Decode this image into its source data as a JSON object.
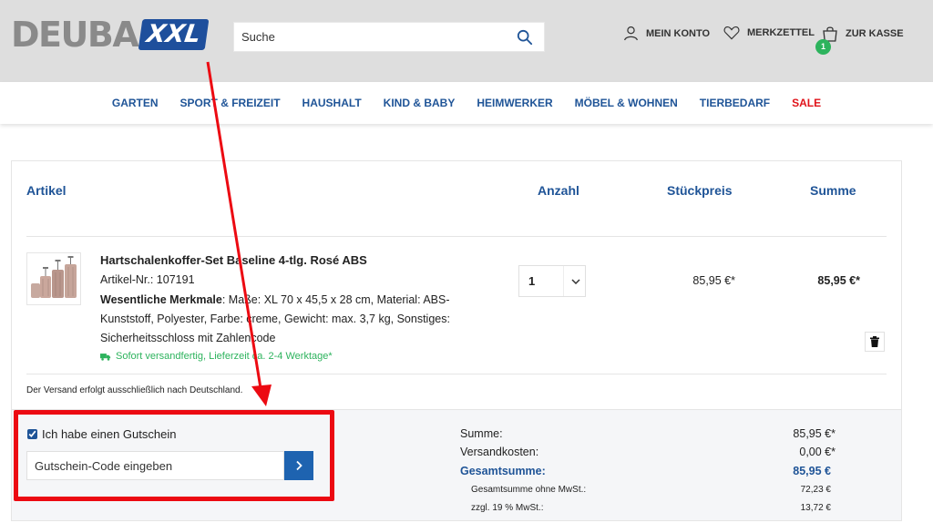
{
  "header": {
    "logo_main": "DEUBA",
    "logo_suffix": "XXL",
    "search_placeholder": "Suche",
    "account_label": "MEIN KONTO",
    "wishlist_label": "MERKZETTEL",
    "checkout_label": "ZUR KASSE",
    "cart_count": "1"
  },
  "nav": {
    "items": [
      "GARTEN",
      "SPORT & FREIZEIT",
      "HAUSHALT",
      "KIND & BABY",
      "HEIMWERKER",
      "MÖBEL & WOHNEN",
      "TIERBEDARF"
    ],
    "sale_label": "SALE"
  },
  "cart": {
    "col_article": "Artikel",
    "col_qty": "Anzahl",
    "col_unit_price": "Stückpreis",
    "col_total": "Summe",
    "item": {
      "title": "Hartschalenkoffer-Set Baseline 4-tlg. Rosé ABS",
      "article_no": "Artikel-Nr.: 107191",
      "features_label": "Wesentliche Merkmale",
      "features_text": ": Maße: XL 70 x 45,5 x 28 cm, Material: ABS-Kunststoff, Polyester, Farbe: creme, Gewicht: max. 3,7 kg, Sonstiges: Sicherheitsschloss mit Zahlencode",
      "shipping_status": "Sofort versandfertig, Lieferzeit ca. 2-4 Werktage*",
      "quantity": "1",
      "unit_price": "85,95 €*",
      "line_total": "85,95 €*"
    },
    "shipping_note": "Der Versand erfolgt ausschließlich nach Deutschland."
  },
  "voucher": {
    "checkbox_label": "Ich habe einen Gutschein",
    "checked": true,
    "input_placeholder": "Gutschein-Code eingeben"
  },
  "summary": {
    "subtotal_label": "Summe:",
    "subtotal_value": "85,95 €*",
    "shipping_label": "Versandkosten:",
    "shipping_value": "0,00 €*",
    "grand_total_label": "Gesamtsumme:",
    "grand_total_value": "85,95 €",
    "net_label": "Gesamtsumme ohne MwSt.:",
    "net_value": "72,23 €",
    "vat_label": "zzgl. 19 % MwSt.:",
    "vat_value": "13,72 €"
  },
  "colors": {
    "brand_blue": "#1f5497",
    "sale_red": "#e0131a",
    "stock_green": "#2db35d",
    "annotation_red": "#ec0a12"
  }
}
